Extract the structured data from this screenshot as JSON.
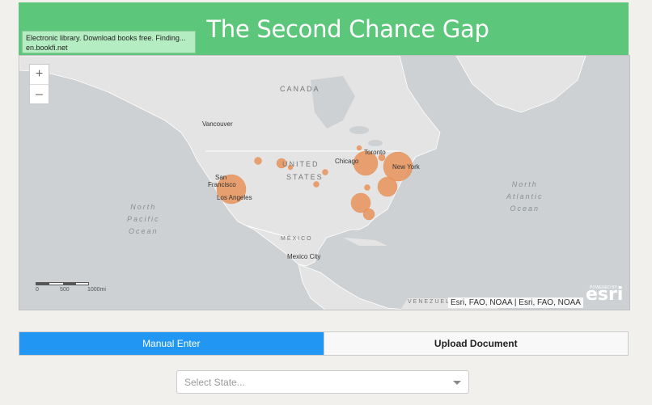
{
  "header": {
    "title": "The Second Chance Gap"
  },
  "tooltip": {
    "line1": "Electronic library. Download books free. Finding...",
    "line2": "en.bookfi.net"
  },
  "map": {
    "zoom_in": "+",
    "zoom_out": "–",
    "countries": {
      "canada": "CANADA",
      "us_line1": "UNITED",
      "us_line2": "STATES",
      "mexico": "MÉXICO",
      "venezuela": "VENEZUELA"
    },
    "oceans": {
      "pacific": "North\nPacific\nOcean",
      "atlantic": "North\nAtlantic\nOcean"
    },
    "cities": {
      "vancouver": "Vancouver",
      "san_francisco_1": "San",
      "san_francisco_2": "Francisco",
      "los_angeles": "Los Angeles",
      "chicago": "Chicago",
      "toronto": "Toronto",
      "new_york": "New York",
      "mexico_city": "Mexico City"
    },
    "scale": {
      "t0": "0",
      "t1": "500",
      "t2": "1000mi"
    },
    "attribution": "Esri, FAO, NOAA | Esri, FAO, NOAA",
    "esri_powered": "POWERED BY",
    "esri_logo": "esri",
    "bubble_color": "#e8935a"
  },
  "tabs": {
    "manual": "Manual Enter",
    "upload": "Upload Document"
  },
  "state_select": {
    "placeholder": "Select State..."
  }
}
